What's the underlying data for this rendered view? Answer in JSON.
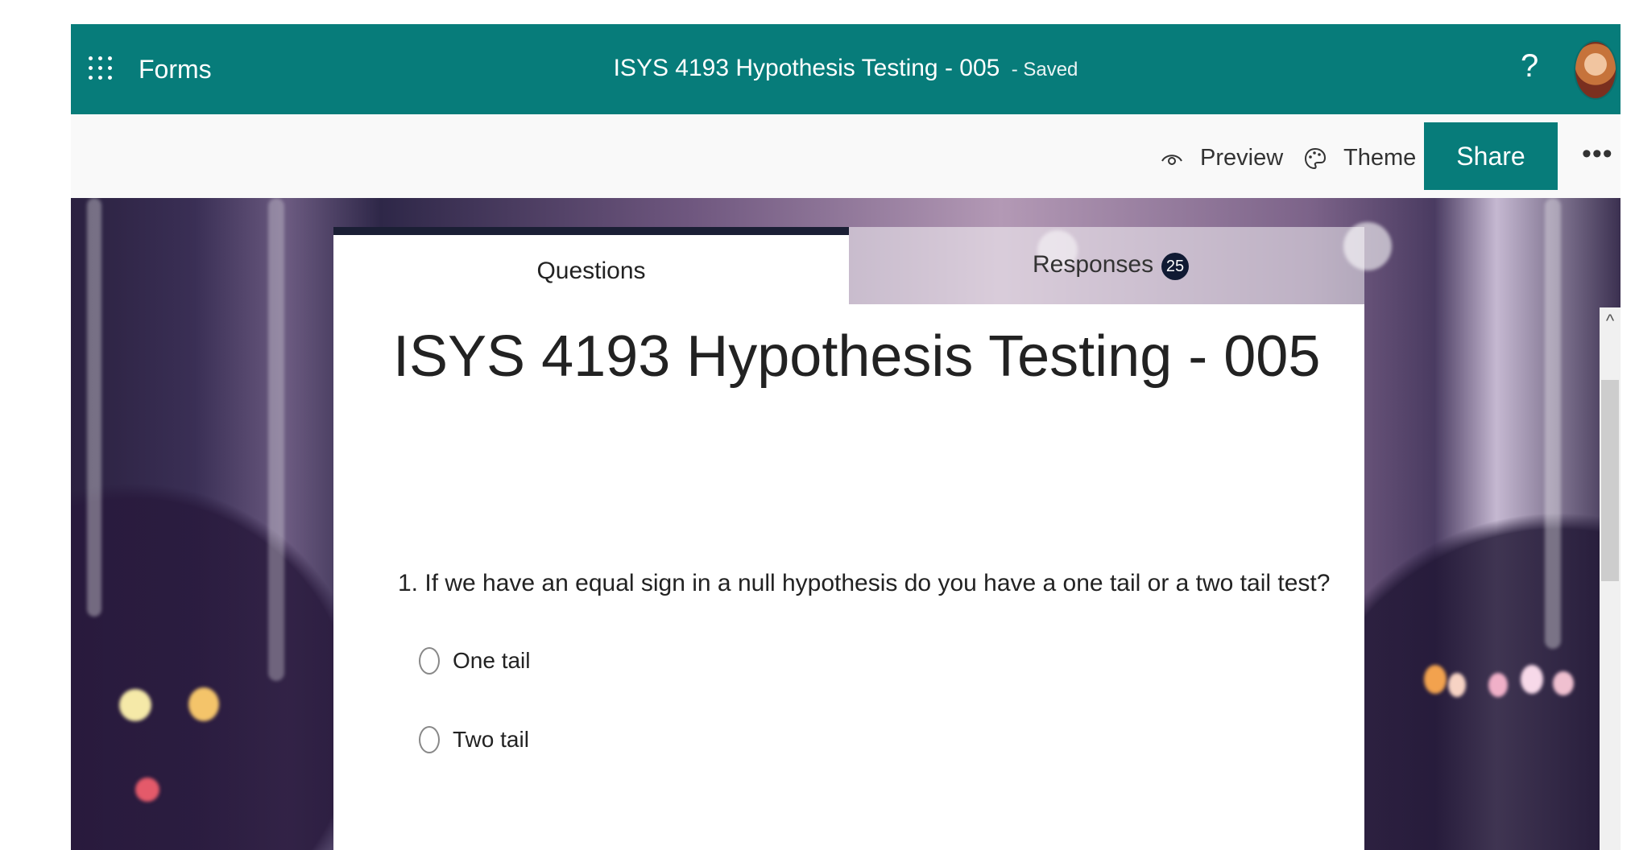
{
  "header": {
    "app_name": "Forms",
    "doc_title": "ISYS 4193 Hypothesis Testing - 005",
    "save_status": "- Saved",
    "help": "?"
  },
  "toolbar": {
    "preview_label": "Preview",
    "theme_label": "Theme",
    "share_label": "Share",
    "more": "•••"
  },
  "tabs": {
    "questions_label": "Questions",
    "responses_label": "Responses",
    "responses_count": "25"
  },
  "form": {
    "title": "ISYS 4193 Hypothesis Testing - 005",
    "questions": [
      {
        "text": "1. If we have an equal sign in a null hypothesis do you have a one tail or a two tail test?",
        "options": [
          "One tail",
          "Two tail"
        ]
      }
    ]
  },
  "scroll": {
    "up_arrow": "^"
  },
  "colors": {
    "brand": "#077c7a",
    "tab_accent": "#1b1f35",
    "badge": "#101a33"
  }
}
